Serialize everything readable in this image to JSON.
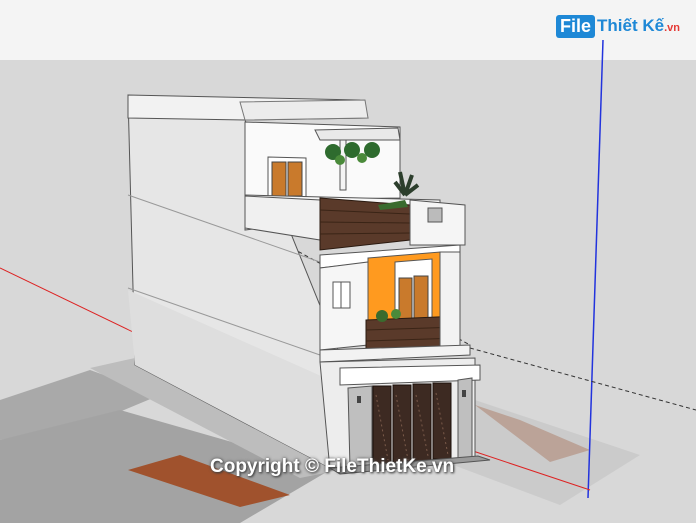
{
  "watermark": {
    "logo_mark": "File",
    "logo_text": "Thiết Kế",
    "logo_domain": ".vn",
    "copyright": "Copyright © FileThietKe.vn"
  },
  "colors": {
    "sky": "#f4f4f4",
    "ground": "#d8d8d8",
    "accent_orange": "#ff9a1f",
    "wood_brown": "#5a3a2a",
    "axis_blue": "#2233dd",
    "axis_red": "#dd2222",
    "brand_blue": "#1e88d6"
  },
  "icons": [
    "copyright-icon"
  ]
}
